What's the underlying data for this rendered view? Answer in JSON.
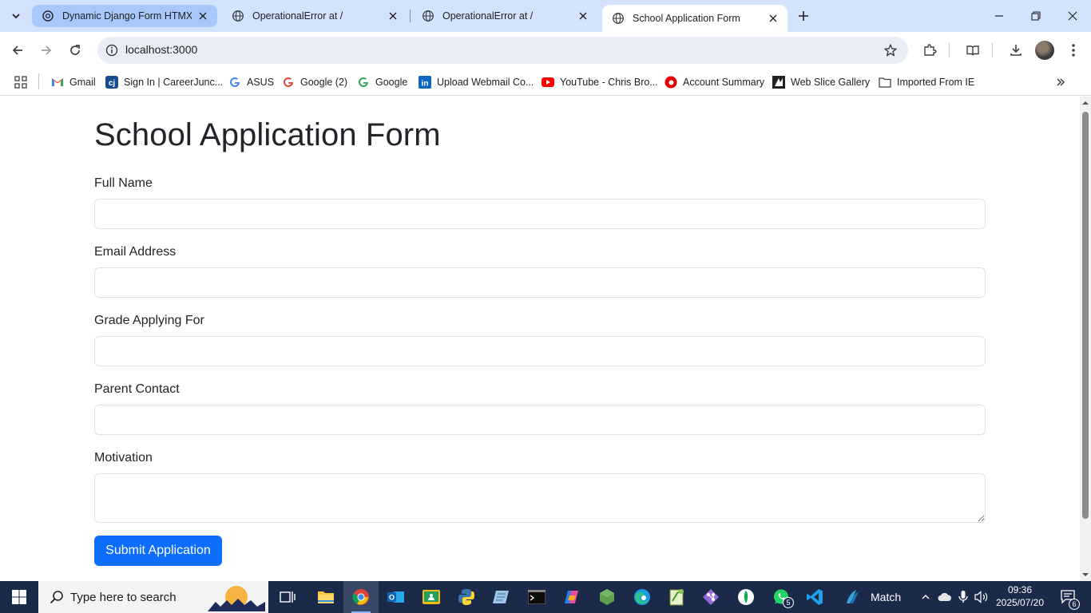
{
  "browser": {
    "tabs": [
      {
        "title": "Dynamic Django Form HTMX",
        "state": "pill"
      },
      {
        "title": "OperationalError at /",
        "state": "normal"
      },
      {
        "title": "OperationalError at /",
        "state": "normal"
      },
      {
        "title": "School Application Form",
        "state": "active"
      }
    ],
    "url": "localhost:3000",
    "bookmarks": [
      {
        "label": "Gmail",
        "icon": "gmail-icon"
      },
      {
        "label": "Sign In | CareerJunc...",
        "icon": "careerjunction-icon"
      },
      {
        "label": "ASUS",
        "icon": "google-icon"
      },
      {
        "label": "Google (2)",
        "icon": "google-icon"
      },
      {
        "label": "Google",
        "icon": "google-icon"
      },
      {
        "label": "Upload Webmail Co...",
        "icon": "linkedin-icon"
      },
      {
        "label": "YouTube - Chris Bro...",
        "icon": "youtube-icon"
      },
      {
        "label": "Account Summary",
        "icon": "vodafone-icon"
      },
      {
        "label": "Web Slice Gallery",
        "icon": "web-slice-icon"
      },
      {
        "label": "Imported From IE",
        "icon": "folder-icon"
      }
    ]
  },
  "form": {
    "title": "School Application Form",
    "fields": [
      {
        "label": "Full Name",
        "value": ""
      },
      {
        "label": "Email Address",
        "value": ""
      },
      {
        "label": "Grade Applying For",
        "value": ""
      },
      {
        "label": "Parent Contact",
        "value": ""
      },
      {
        "label": "Motivation",
        "value": ""
      }
    ],
    "submit_label": "Submit Application"
  },
  "taskbar": {
    "search_placeholder": "Type here to search",
    "whatsapp_badge": "5",
    "weather_label": "Match",
    "time": "09:36",
    "date": "2025/07/20",
    "notification_count": "6"
  },
  "colors": {
    "primary": "#0d6efd",
    "tabstrip": "#d3e3fd",
    "taskbar": "#1c2a4a"
  }
}
